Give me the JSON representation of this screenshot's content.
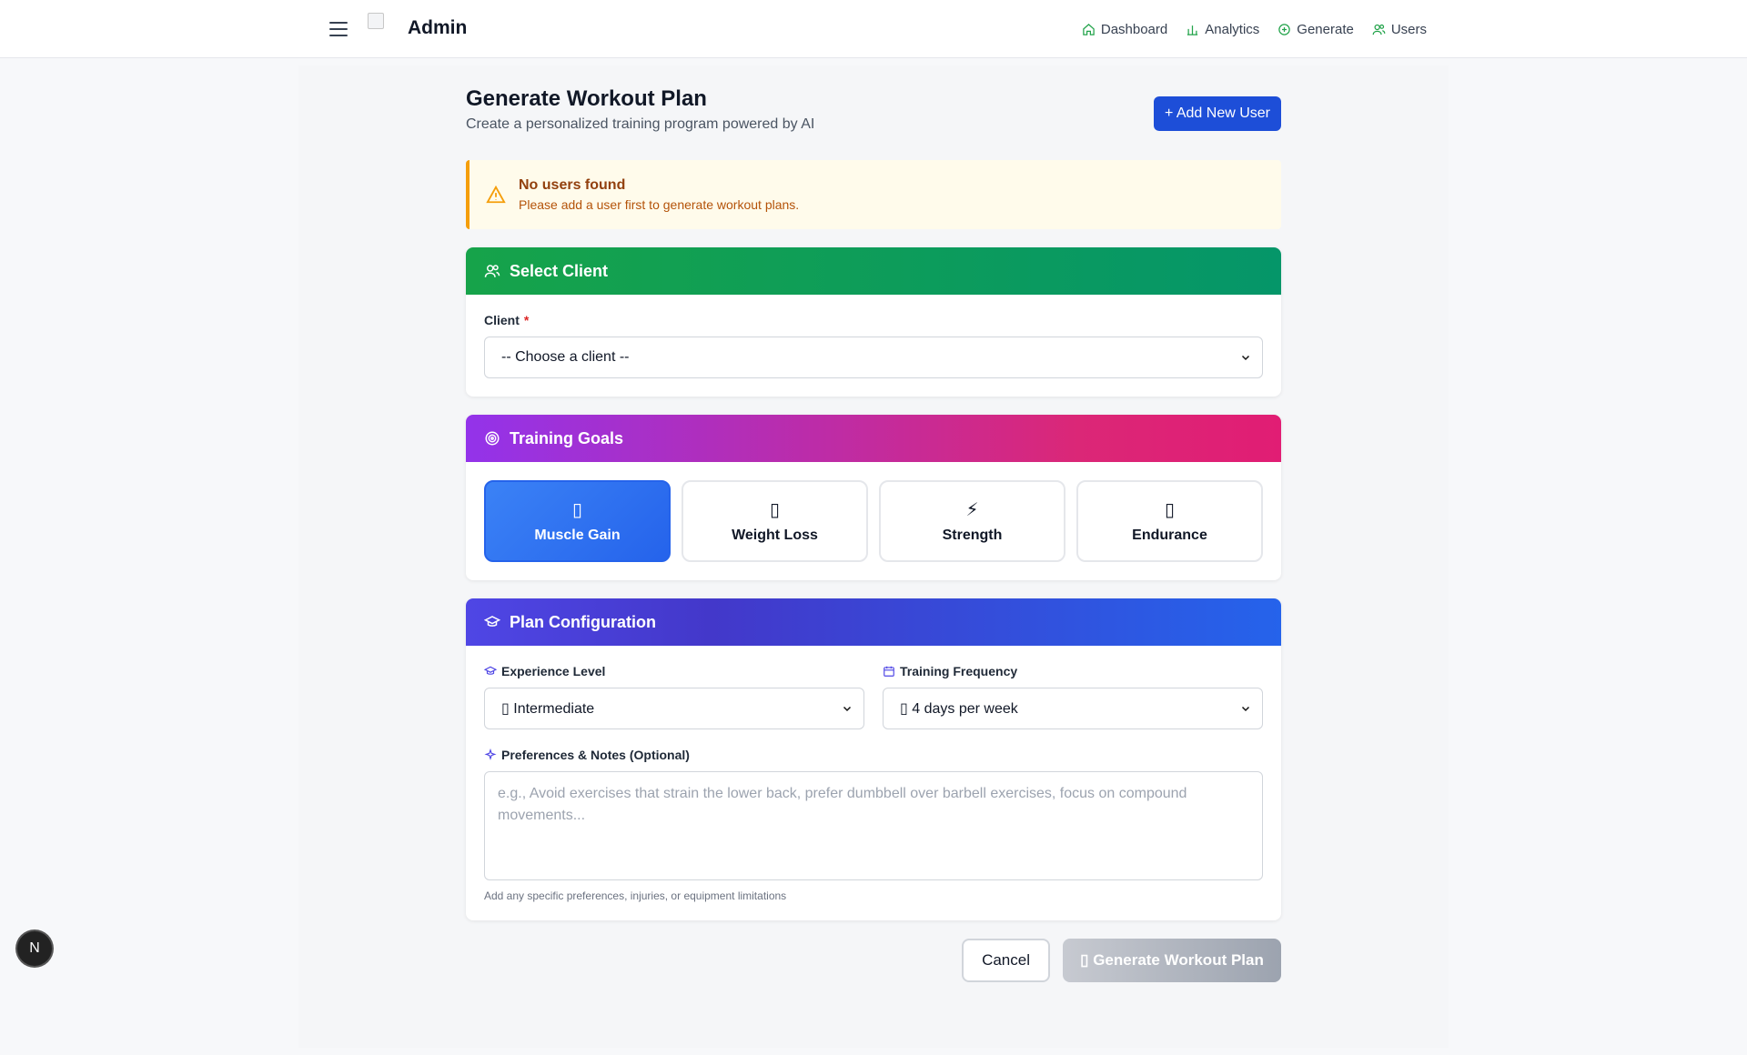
{
  "nav": {
    "brand": "Admin",
    "items": [
      {
        "label": "Dashboard",
        "icon": "home-icon"
      },
      {
        "label": "Analytics",
        "icon": "bar-chart-icon"
      },
      {
        "label": "Generate",
        "icon": "plus-circle-icon"
      },
      {
        "label": "Users",
        "icon": "users-icon"
      }
    ],
    "icon_color": "#22a34a"
  },
  "page": {
    "title": "Generate Workout Plan",
    "subtitle": "Create a personalized training program powered by AI",
    "add_user_label": "+ Add New User"
  },
  "alert": {
    "title": "No users found",
    "text": "Please add a user first to generate workout plans."
  },
  "client_card": {
    "heading": "Select Client",
    "field_label": "Client",
    "required_mark": "*",
    "selected": "-- Choose a client --"
  },
  "goals_card": {
    "heading": "Training Goals",
    "goals": [
      {
        "label": "Muscle Gain",
        "icon": "▯",
        "active": true
      },
      {
        "label": "Weight Loss",
        "icon": "▯",
        "active": false
      },
      {
        "label": "Strength",
        "icon": "⚡",
        "active": false
      },
      {
        "label": "Endurance",
        "icon": "▯",
        "active": false
      }
    ]
  },
  "config_card": {
    "heading": "Plan Configuration",
    "experience_label": "Experience Level",
    "experience_value": "▯ Intermediate",
    "frequency_label": "Training Frequency",
    "frequency_value": "▯ 4 days per week",
    "notes_label": "Preferences & Notes (Optional)",
    "notes_placeholder": "e.g., Avoid exercises that strain the lower back, prefer dumbbell over barbell exercises, focus on compound movements...",
    "notes_hint": "Add any specific preferences, injuries, or equipment limitations"
  },
  "actions": {
    "cancel_label": "Cancel",
    "generate_label": "▯ Generate Workout Plan"
  },
  "badge": "N"
}
